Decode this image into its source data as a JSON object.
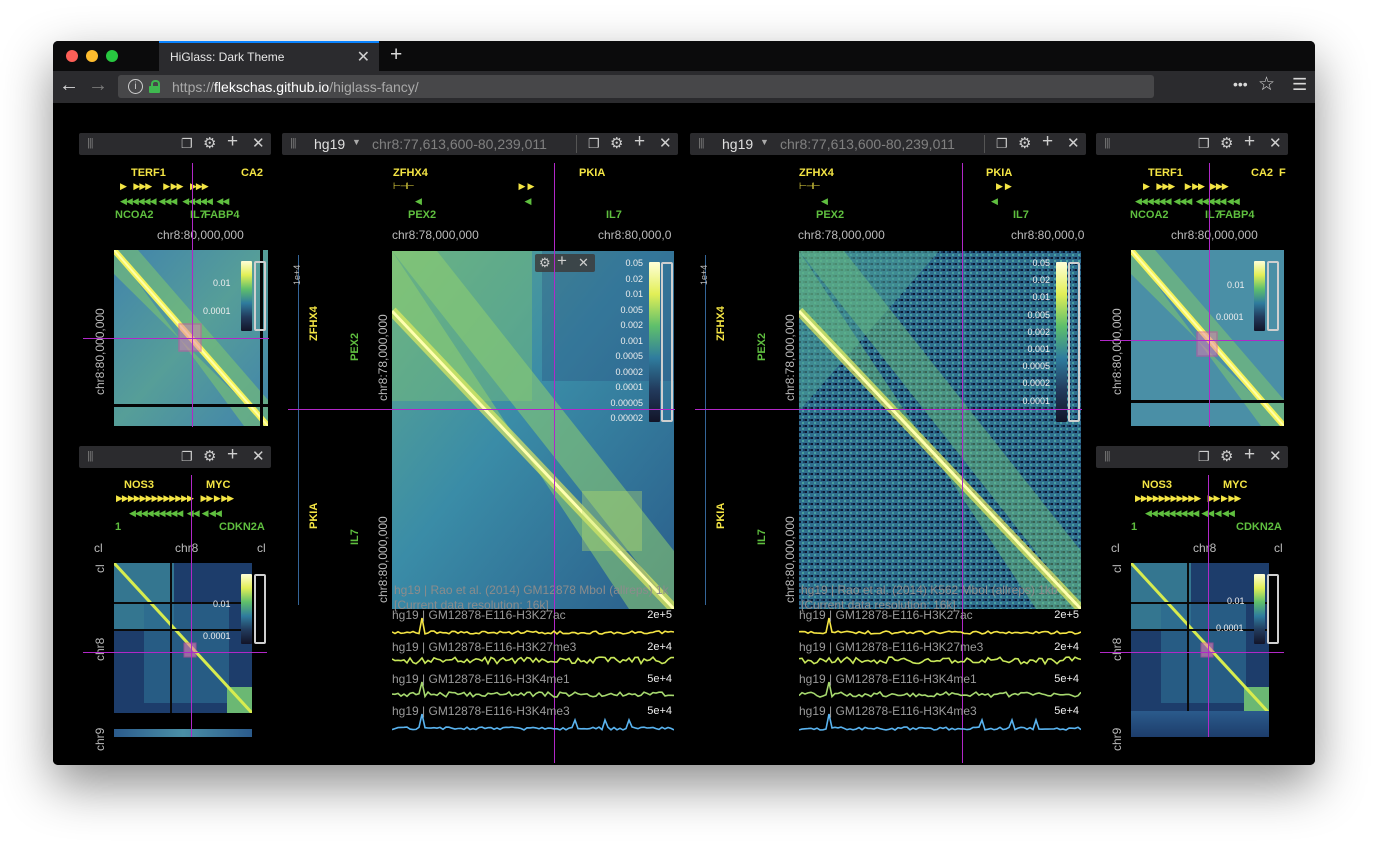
{
  "browser": {
    "tab_title": "HiGlass: Dark Theme",
    "tab_close": "✕",
    "new_tab": "+",
    "url_scheme": "https://",
    "url_host": "flekschas.github.io",
    "url_path": "/higlass-fancy/",
    "menu_more": "•••",
    "bookmark_star": "☆",
    "hamburger": "☰",
    "back": "←",
    "forward": "→",
    "info": "i"
  },
  "views": {
    "genome": "hg19",
    "location": "chr8:77,613,600-80,239,011"
  },
  "colors": {
    "accent_tab": "#0a84ff",
    "crosshair": "#b128c8",
    "gene_plus": "#f4e544",
    "gene_minus": "#5fbf3f",
    "tracks": [
      "#f4e544",
      "#c9e85a",
      "#a6d86e",
      "#5ab4f0"
    ]
  },
  "genes": {
    "overview_top": [
      "TERF1",
      "CA2",
      "NCOA2",
      "IL7",
      "FABP4"
    ],
    "overview_top_right": [
      "TERF1",
      "CA2",
      "F",
      "NCOA2",
      "IL7",
      "FABP4"
    ],
    "overview_bottom": [
      "NOS3",
      "MYC",
      "1",
      "CDKN2A"
    ],
    "main_top": [
      "ZFHX4",
      "PKIA",
      "PEX2",
      "IL7"
    ],
    "main_left_top": [
      "ZFHX4",
      "PEX2"
    ],
    "main_left_bottom": [
      "PKIA",
      "IL7"
    ]
  },
  "axes": {
    "overview_x": "chr8:80,000,000",
    "overview_y": "chr8:80,000,000",
    "chrom_x": "chr8",
    "chrom_left": "cl",
    "chrom_right": "cl",
    "chrom_y": "chr8",
    "chrom_y_top": "cl",
    "chrom_y_bottom": "chr9",
    "main_x_left": "chr8:78,000,000",
    "main_x_right": "chr8:80,000,0",
    "main_y_top": "chr8:78,000,000",
    "main_y_bottom": "chr8:80,000,000",
    "vertical_scale": "1e+4"
  },
  "colorbars": {
    "overview": [
      "0.01",
      "0.0001"
    ],
    "main_left": [
      "0.05",
      "0.02",
      "0.01",
      "0.005",
      "0.002",
      "0.001",
      "0.0005",
      "0.0002",
      "0.0001",
      "0.00005",
      "0.00002"
    ],
    "main_right": [
      "0.05",
      "0.02",
      "0.01",
      "0.005",
      "0.002",
      "0.001",
      "0.0005",
      "0.0002",
      "0.0001"
    ]
  },
  "heatmaps": {
    "left_label": "hg19 | Rao et al. (2014) GM12878 MboI (allreps) 1k",
    "left_resolution": "[Current data resolution: 16k]",
    "right_label": "hg19 | Rao et al. (2014) K562 MboI (allreps) 1kb",
    "right_resolution": "[Current data resolution: 16k]"
  },
  "tracks": [
    {
      "name": "hg19 | GM12878-E116-H3K27ac",
      "max": "2e+5"
    },
    {
      "name": "hg19 | GM12878-E116-H3K27me3",
      "max": "2e+4"
    },
    {
      "name": "hg19 | GM12878-E116-H3K4me1",
      "max": "5e+4"
    },
    {
      "name": "hg19 | GM12878-E116-H3K4me3",
      "max": "5e+4"
    }
  ],
  "icons": {
    "copy": "❐",
    "settings": "⚙",
    "add": "+",
    "close": "✕",
    "grip": "|||",
    "dropdown": "▼"
  }
}
